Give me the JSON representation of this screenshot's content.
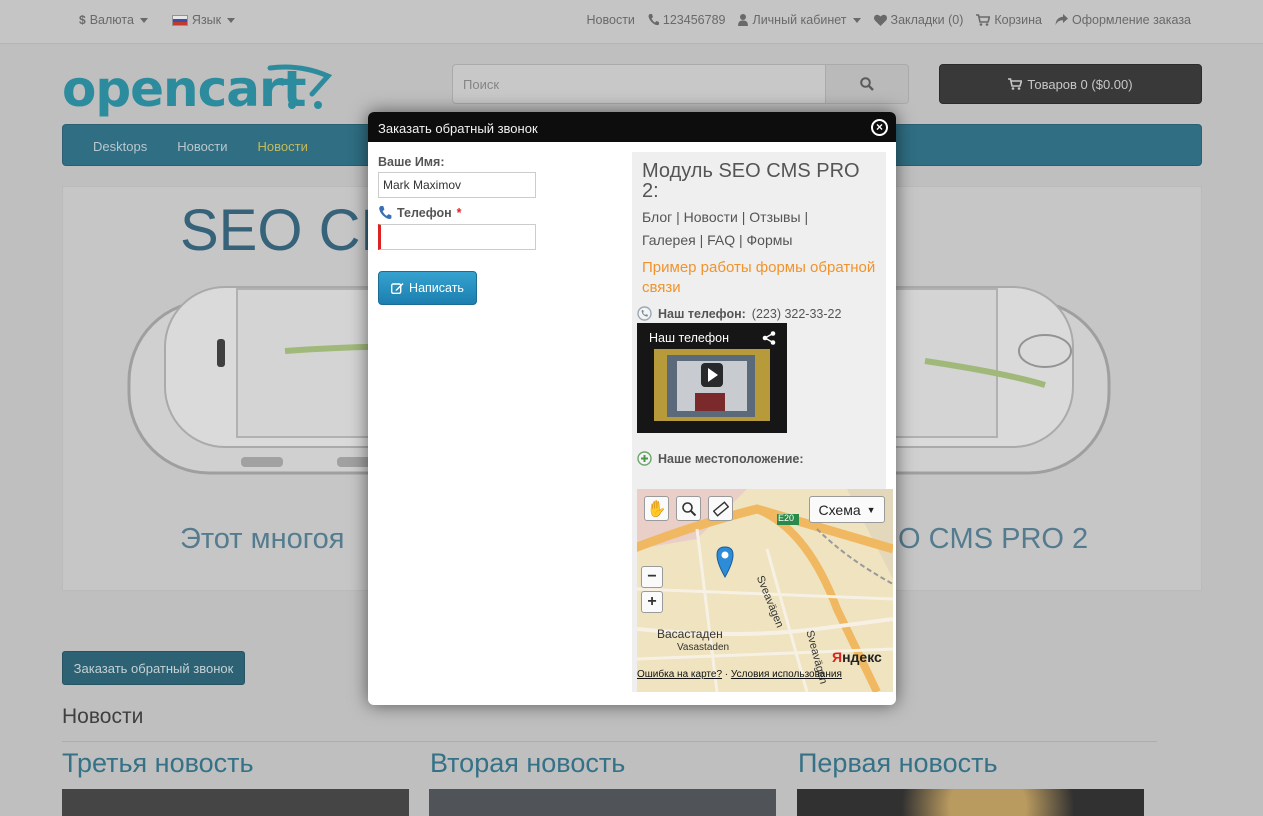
{
  "topbar": {
    "currency": "Валюта",
    "language": "Язык",
    "news": "Новости",
    "phone": "123456789",
    "account": "Личный кабинет",
    "wishlist": "Закладки (0)",
    "cart": "Корзина",
    "checkout": "Оформление заказа"
  },
  "header": {
    "logo": "opencart",
    "search_placeholder": "Поиск",
    "cart_button": "Товаров 0 ($0.00)"
  },
  "nav": {
    "items": [
      "Desktops",
      "Новости",
      "Новости"
    ]
  },
  "slide": {
    "title": "SEO CM",
    "subtitle_left": "Этот многоя",
    "subtitle_right": "O CMS PRO 2"
  },
  "callback_button": "Заказать обратный звонок",
  "news": {
    "heading": "Новости",
    "items": [
      "Третья новость",
      "Вторая новость",
      "Первая новость"
    ]
  },
  "modal": {
    "title": "Заказать обратный звонок",
    "name_label": "Ваше Имя:",
    "name_value": "Mark Maximov",
    "phone_label": "Телефон",
    "required_mark": "*",
    "submit_label": "Написать",
    "side": {
      "title": "Модуль SEO CMS PRO 2:",
      "links_line1": "Блог | Новости | Отзывы |",
      "links_line2": "Галерея | FAQ | Формы",
      "example": "Пример работы формы обратной связи",
      "phone_label": "Наш телефон:",
      "phone_value": "(223) 322-33-22",
      "video_title": "Наш телефон",
      "location_label": "Наше местоположение:",
      "map": {
        "type_button": "Схема",
        "road_label": "E20",
        "street_1": "Sveavägen",
        "street_2": "Sveavägen",
        "district_ru": "Васастаден",
        "district": "Vasastaden",
        "brand_first": "Я",
        "brand_rest": "ндекс",
        "footer_error": "Ошибка на карте?",
        "footer_terms": "Условия использования"
      }
    }
  },
  "colors": {
    "accent": "#1b91a6",
    "nav_bg": "#1f6c86",
    "orange": "#f0932b",
    "button_blue": "#1c7fb0"
  }
}
